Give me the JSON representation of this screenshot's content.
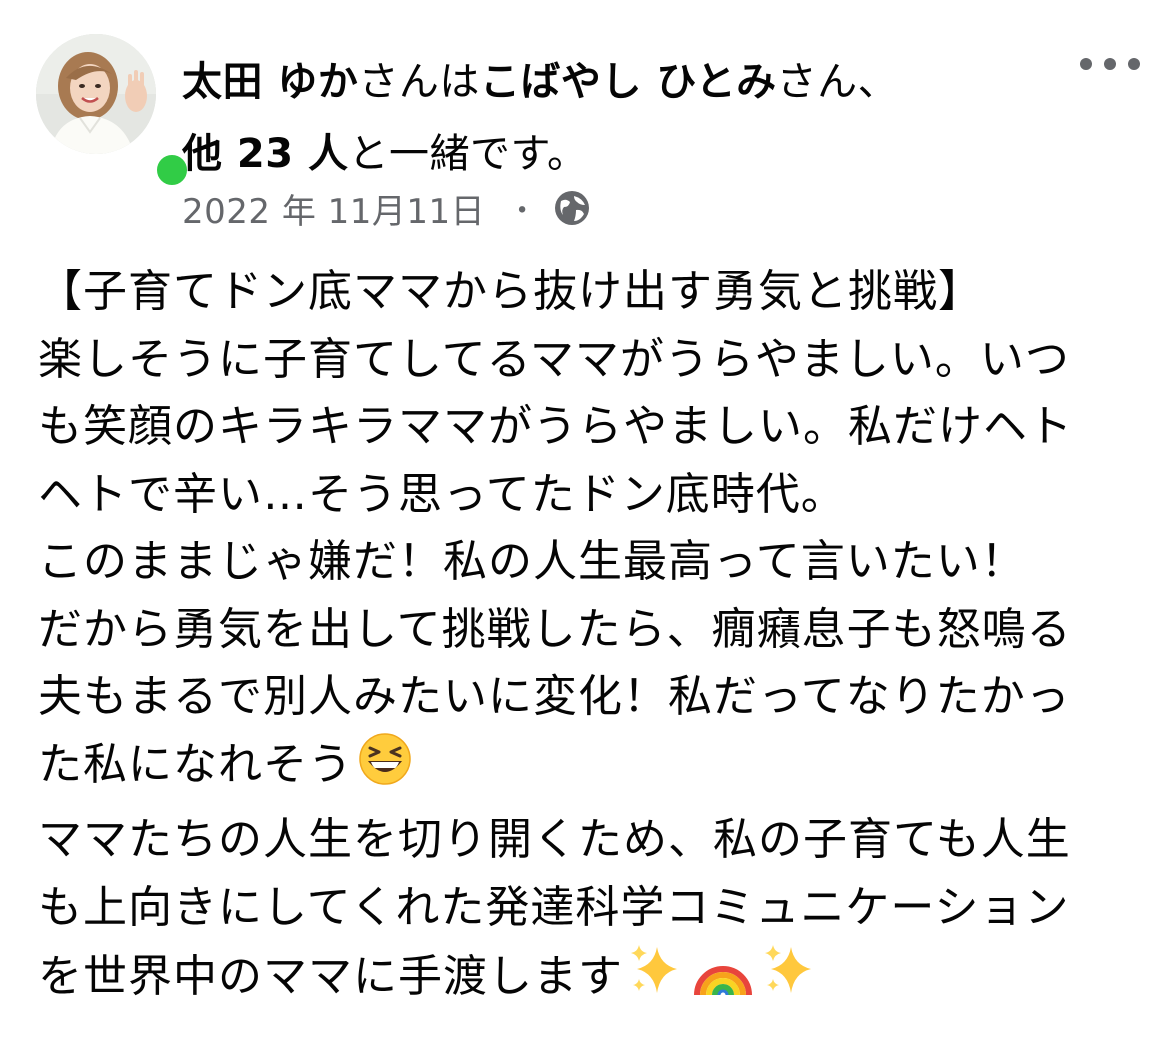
{
  "post": {
    "author_name": "太田 ゆか",
    "text_san_wa": "さんは",
    "tagged_name": "こばやし ひとみ",
    "text_san_comma": "さん、",
    "tagged_others": "他 23 人",
    "text_together": "と一緒です。",
    "date": "2022 年 11月11日",
    "date_separator": "・",
    "privacy_icon": "globe-icon",
    "more_icon": "more-horizontal-icon",
    "online_status_color": "#31cc46",
    "body_lines": [
      "【子育てドン底ママから抜け出す勇気と挑戦】",
      "楽しそうに子育てしてるママがうらやましい。いつ",
      "も笑顔のキラキラママがうらやましい。私だけヘト",
      "ヘトで辛い…そう思ってたドン底時代。",
      "このままじゃ嫌だ！私の人生最高って言いたい！",
      "だから勇気を出して挑戦したら、癇癪息子も怒鳴る",
      "夫もまるで別人みたいに変化！私だってなりたかっ",
      "た私になれそう",
      "ママたちの人生を切り開くため、私の子育ても人生",
      "も上向きにしてくれた発達科学コミュニケーション",
      "を世界中のママに手渡します"
    ],
    "emojis": {
      "laughing": "laughing-face-icon",
      "sparkles": "sparkles-icon",
      "rainbow": "rainbow-icon"
    }
  }
}
